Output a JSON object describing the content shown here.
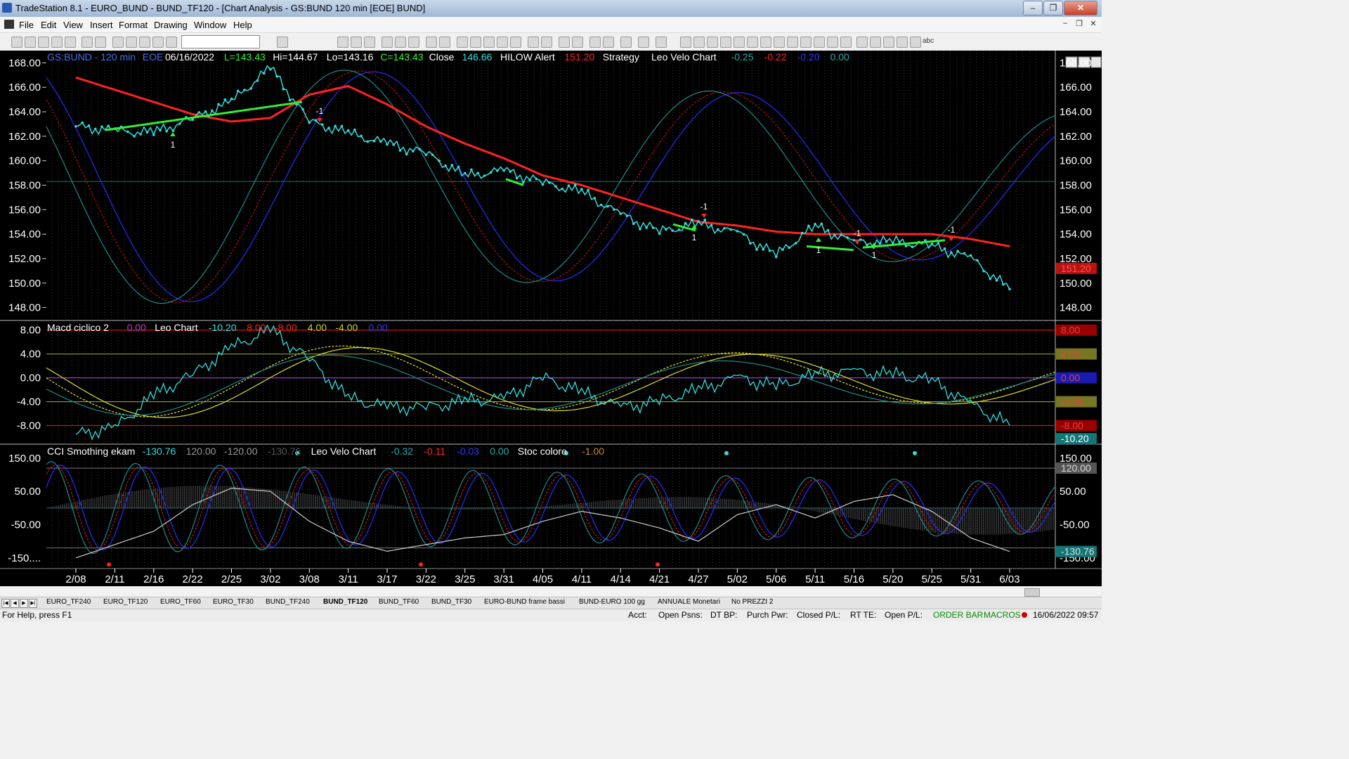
{
  "window": {
    "title": "TradeStation 8.1 - EURO_BUND - BUND_TF120 - [Chart Analysis - GS:BUND  120 min  [EOE] BUND]",
    "controls": {
      "minimize": "‒",
      "maximize": "❐",
      "close": "✕"
    }
  },
  "menu": {
    "items": [
      "File",
      "Edit",
      "View",
      "Insert",
      "Format",
      "Drawing",
      "Window",
      "Help"
    ],
    "mdi_controls": [
      "‒",
      "❐",
      "✕"
    ]
  },
  "toolbar": {
    "text_tool": "abc"
  },
  "chart": {
    "header": [
      {
        "text": "GS:BUND - 120 min",
        "color": "#4a6ee8"
      },
      {
        "text": "EOE",
        "color": "#4a6ee8"
      },
      {
        "text": "06/16/2022",
        "color": "#ffffff"
      },
      {
        "text": "L=143.43",
        "color": "#33ee33"
      },
      {
        "text": "Hi=144.67",
        "color": "#ffffff"
      },
      {
        "text": "Lo=143.16",
        "color": "#ffffff"
      },
      {
        "text": "C=143.43",
        "color": "#33ee33"
      },
      {
        "text": "Close",
        "color": "#ffffff"
      },
      {
        "text": "146.66",
        "color": "#33dddd"
      },
      {
        "text": "HILOW Alert",
        "color": "#ffffff"
      },
      {
        "text": "151.20",
        "color": "#ff2222"
      },
      {
        "text": "Strategy",
        "color": "#ffffff"
      },
      {
        "text": "Leo Velo Chart",
        "color": "#ffffff"
      },
      {
        "text": "-0.25",
        "color": "#2aa8a8"
      },
      {
        "text": "-0.22",
        "color": "#ff2222"
      },
      {
        "text": "-0.20",
        "color": "#3333ff"
      },
      {
        "text": "0.00",
        "color": "#2aa8a8"
      }
    ],
    "price_axis": [
      "168.00",
      "166.00",
      "164.00",
      "162.00",
      "160.00",
      "158.00",
      "156.00",
      "154.00",
      "152.00",
      "150.00",
      "148.00"
    ],
    "price_right_tag": "151.20",
    "macd": {
      "header": [
        {
          "text": "Macd ciclico 2",
          "color": "#ffffff"
        },
        {
          "text": "0.00",
          "color": "#cc33cc"
        },
        {
          "text": "Leo Chart",
          "color": "#ffffff"
        },
        {
          "text": "-10.20",
          "color": "#33dddd"
        },
        {
          "text": "8.00",
          "color": "#ff2222"
        },
        {
          "text": "-8.00",
          "color": "#ff2222"
        },
        {
          "text": "4.00",
          "color": "#cccc33"
        },
        {
          "text": "-4.00",
          "color": "#cccc33"
        },
        {
          "text": "0.00",
          "color": "#3333ff"
        }
      ],
      "axis": [
        "8.00",
        "4.00",
        "0.00",
        "-4.00",
        "-8.00"
      ],
      "right_tags": [
        "8.00",
        "4.00",
        "0.00",
        "-4.00",
        "-8.00",
        "-10.20"
      ]
    },
    "cci": {
      "header": [
        {
          "text": "CCI Smothing ekam",
          "color": "#ffffff"
        },
        {
          "text": "-130.76",
          "color": "#33dddd"
        },
        {
          "text": "120.00",
          "color": "#999999"
        },
        {
          "text": "-120.00",
          "color": "#999999"
        },
        {
          "text": "-130.76",
          "color": "#555555"
        },
        {
          "text": "Leo Velo Chart",
          "color": "#ffffff"
        },
        {
          "text": "-0.32",
          "color": "#2aa8a8"
        },
        {
          "text": "-0.11",
          "color": "#ff2222"
        },
        {
          "text": "-0.03",
          "color": "#3333ff"
        },
        {
          "text": "0.00",
          "color": "#2aa8a8"
        },
        {
          "text": "Stoc colore",
          "color": "#ffffff"
        },
        {
          "text": "-1.00",
          "color": "#cc8822"
        }
      ],
      "axis": [
        "150.00",
        "50.00",
        "-50.00",
        "-150...."
      ],
      "right_axis": [
        "150.00",
        "50.00",
        "-50.00",
        "-150.00"
      ],
      "right_tags": [
        "120.00",
        "-130.76"
      ]
    },
    "x_axis": [
      "2/08",
      "2/11",
      "2/16",
      "2/22",
      "2/25",
      "3/02",
      "3/08",
      "3/11",
      "3/17",
      "3/22",
      "3/25",
      "3/31",
      "4/05",
      "4/11",
      "4/14",
      "4/21",
      "4/27",
      "5/02",
      "5/06",
      "5/11",
      "5/16",
      "5/20",
      "5/25",
      "5/31",
      "6/03"
    ],
    "signals": [
      "1",
      "-1",
      "1",
      "-1",
      "1",
      "-1",
      "1",
      "-1"
    ]
  },
  "tabs": [
    "EURO_TF240",
    "EURO_TF120",
    "EURO_TF60",
    "EURO_TF30",
    "BUND_TF240",
    "BUND_TF120",
    "BUND_TF60",
    "BUND_TF30",
    "EURO-BUND frame bassi",
    "BUND-EURO 100 gg",
    "ANNUALE Monetari",
    "No PREZZI 2"
  ],
  "active_tab": "BUND_TF120",
  "status": {
    "help": "For Help, press F1",
    "acct": "Acct:",
    "open_psns": "Open Psns:",
    "dt_bp": "DT BP:",
    "purch_pwr": "Purch Pwr:",
    "closed_pl": "Closed P/L:",
    "rt_te": "RT TE:",
    "open_pl": "Open P/L:",
    "order_bar": "ORDER BAR",
    "macros": "MACROS",
    "datetime": "16/06/2022 09:57"
  },
  "chart_data": [
    {
      "type": "line",
      "title": "GS:BUND - 120 min",
      "ylim": [
        147,
        169
      ],
      "x": [
        "2/08",
        "2/11",
        "2/16",
        "2/22",
        "2/25",
        "3/02",
        "3/08",
        "3/11",
        "3/17",
        "3/22",
        "3/25",
        "3/31",
        "4/05",
        "4/11",
        "4/14",
        "4/21",
        "4/27",
        "5/02",
        "5/06",
        "5/11",
        "5/16",
        "5/20",
        "5/25",
        "5/31",
        "6/03"
      ],
      "series": [
        {
          "name": "Close",
          "color": "#33dddd",
          "values": [
            162.8,
            162.4,
            162.3,
            163.4,
            164.8,
            167.6,
            163.2,
            162.2,
            161.4,
            160.6,
            158.7,
            159.2,
            158.2,
            157.4,
            155.6,
            154.2,
            154.8,
            154.1,
            152.3,
            154.6,
            153.3,
            153.4,
            153.0,
            152.0,
            149.5
          ]
        },
        {
          "name": "HILOW Alert",
          "color": "#ff2222",
          "values": [
            166.8,
            165.8,
            164.8,
            163.8,
            163.2,
            163.5,
            165.4,
            166.1,
            164.6,
            162.8,
            161.4,
            160.2,
            158.8,
            158.0,
            157.0,
            156.0,
            155.0,
            154.7,
            154.2,
            154.0,
            154.0,
            154.0,
            154.0,
            153.6,
            153.0
          ]
        }
      ]
    },
    {
      "type": "line",
      "title": "Macd ciclico 2",
      "ylim": [
        -11,
        9.5
      ],
      "x": [
        "2/08",
        "2/11",
        "2/16",
        "2/22",
        "2/25",
        "3/02",
        "3/08",
        "3/11",
        "3/17",
        "3/22",
        "3/25",
        "3/31",
        "4/05",
        "4/11",
        "4/14",
        "4/21",
        "4/27",
        "5/02",
        "5/06",
        "5/11",
        "5/16",
        "5/20",
        "5/25",
        "5/31",
        "6/03"
      ],
      "series": [
        {
          "name": "Leo Chart",
          "color": "#33dddd",
          "values": [
            -9.5,
            -8.5,
            -3.0,
            0.5,
            5.0,
            8.0,
            3.0,
            -3.5,
            -5.0,
            -5.0,
            -4.0,
            -3.5,
            0.0,
            -2.5,
            -5.0,
            -4.0,
            -2.0,
            0.0,
            -1.5,
            0.5,
            1.0,
            0.5,
            -0.5,
            -4.5,
            -8.0
          ]
        }
      ]
    },
    {
      "type": "line",
      "title": "CCI Smothing ekam",
      "ylim": [
        -180,
        190
      ],
      "x": [
        "2/08",
        "2/11",
        "2/16",
        "2/22",
        "2/25",
        "3/02",
        "3/08",
        "3/11",
        "3/17",
        "3/22",
        "3/25",
        "3/31",
        "4/05",
        "4/11",
        "4/14",
        "4/21",
        "4/27",
        "5/02",
        "5/06",
        "5/11",
        "5/16",
        "5/20",
        "5/25",
        "5/31",
        "6/03"
      ],
      "series": [
        {
          "name": "CCI Smothing ekam",
          "color": "#cccccc",
          "values": [
            -150.0,
            -110.0,
            -70.0,
            10.0,
            60.0,
            50.0,
            -40.0,
            -100.0,
            -130.0,
            -110.0,
            -90.0,
            -80.0,
            -40.0,
            -10.0,
            -30.0,
            -60.0,
            -100.0,
            -20.0,
            10.0,
            -30.0,
            20.0,
            40.0,
            -10.0,
            -90.0,
            -130.76
          ]
        }
      ]
    }
  ]
}
